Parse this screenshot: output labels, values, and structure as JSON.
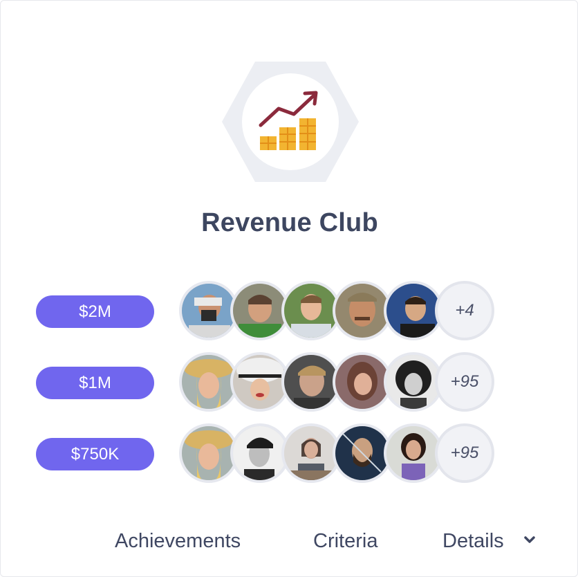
{
  "badge": {
    "icon": "revenue-growth-chart-icon",
    "colors": {
      "hexagon": "#eceef3",
      "arrow": "#8b2a3c",
      "coins": "#f2b431"
    }
  },
  "title": "Revenue Club",
  "tiers": [
    {
      "label": "$2M",
      "more": "+4",
      "avatars": [
        "camera-man-avatar",
        "green-shirt-man-avatar",
        "smiling-young-man-avatar",
        "mustache-man-avatar",
        "man-dark-background-avatar"
      ]
    },
    {
      "label": "$1M",
      "more": "+95",
      "avatars": [
        "woman-straw-hat-avatar",
        "woman-white-hat-avatar",
        "blond-man-avatar",
        "brunette-woman-avatar",
        "curly-hair-woman-avatar"
      ]
    },
    {
      "label": "$750K",
      "more": "+95",
      "avatars": [
        "woman-straw-hat-avatar",
        "man-bw-portrait-avatar",
        "woman-office-avatar",
        "bearded-man-avatar",
        "woman-purple-top-avatar"
      ]
    }
  ],
  "tabs": {
    "achievements": "Achievements",
    "criteria": "Criteria",
    "details": "Details"
  },
  "accent_color": "#7066ee"
}
